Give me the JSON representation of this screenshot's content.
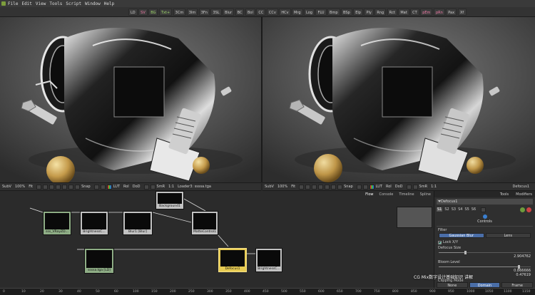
{
  "app": {
    "name": "Fusion"
  },
  "menu": [
    "File",
    "Edit",
    "View",
    "Tools",
    "Script",
    "Window",
    "Help"
  ],
  "toolbar": {
    "buttons": [
      {
        "label": "LD",
        "color": ""
      },
      {
        "label": "SV",
        "color": "pink"
      },
      {
        "label": "BG",
        "color": "green"
      },
      {
        "label": "Txt+",
        "color": "green"
      },
      {
        "label": "3Cm",
        "color": ""
      },
      {
        "label": "3Im",
        "color": ""
      },
      {
        "label": "3Fn",
        "color": ""
      },
      {
        "label": "3SL",
        "color": ""
      },
      {
        "label": "Blur",
        "color": ""
      },
      {
        "label": "BC",
        "color": ""
      },
      {
        "label": "Bol",
        "color": ""
      },
      {
        "label": "CC",
        "color": ""
      },
      {
        "label": "CCv",
        "color": ""
      },
      {
        "label": "HCv",
        "color": ""
      },
      {
        "label": "Mrg",
        "color": ""
      },
      {
        "label": "Log",
        "color": ""
      },
      {
        "label": "FLU",
        "color": ""
      },
      {
        "label": "Bmp",
        "color": ""
      },
      {
        "label": "BSp",
        "color": ""
      },
      {
        "label": "Elp",
        "color": ""
      },
      {
        "label": "Ply",
        "color": ""
      },
      {
        "label": "Rng",
        "color": ""
      },
      {
        "label": "Rct",
        "color": ""
      },
      {
        "label": "Mat",
        "color": ""
      },
      {
        "label": "CT",
        "color": ""
      },
      {
        "label": "pEm",
        "color": "pink"
      },
      {
        "label": "pRn",
        "color": "pink"
      },
      {
        "label": "Pax",
        "color": ""
      },
      {
        "label": "Xf",
        "color": ""
      }
    ]
  },
  "viewer_left": {
    "bar": {
      "subview": "SubV",
      "zoom": "100%",
      "fit": "Fit",
      "snap": "Snap",
      "lut": "LUT",
      "roi": "RoI",
      "dod": "DoD",
      "smr": "SmR",
      "ratio": "1:1",
      "loader": "Loader3: ssssa.tga"
    }
  },
  "viewer_right": {
    "bar": {
      "subview": "SubV",
      "zoom": "100%",
      "fit": "Fit",
      "snap": "Snap",
      "lut": "LUT",
      "roi": "RoI",
      "dod": "DoD",
      "smr": "SmR",
      "ratio": "1:1",
      "tool": "Defocus1"
    }
  },
  "flow": {
    "tabs": [
      "Flow",
      "Console",
      "Timeline",
      "Spline"
    ],
    "nodes": [
      {
        "label": "sss_VRayZD...",
        "kind": "green"
      },
      {
        "label": "BrightnessC...",
        "kind": "gray"
      },
      {
        "label": "Blur1 [Blur]",
        "kind": "gray"
      },
      {
        "label": "Background1",
        "kind": "gray"
      },
      {
        "label": "MatteControl1",
        "kind": "gray"
      },
      {
        "label": "ssssa.tga [LD]",
        "kind": "green"
      },
      {
        "label": "Defocus1",
        "kind": "yellow"
      },
      {
        "label": "BrightnessC...",
        "kind": "gray"
      }
    ]
  },
  "ruler": {
    "ticks": [
      "0",
      "10",
      "20",
      "30",
      "40",
      "50",
      "60",
      "100",
      "150",
      "200",
      "250",
      "300",
      "350",
      "400",
      "450",
      "500",
      "550",
      "600",
      "650",
      "700",
      "750",
      "800",
      "850",
      "900",
      "950",
      "1000",
      "1050",
      "1100",
      "1150"
    ]
  },
  "tools": {
    "tabs": [
      "Tools",
      "Modifiers"
    ],
    "tool_name": "Defocus1",
    "slots": [
      "S1",
      "S2",
      "S3",
      "S4",
      "S5",
      "S6"
    ],
    "controls_label": "Controls",
    "filter_label": "Filter",
    "filter_options": [
      "Gaussian Blur",
      "Lens"
    ],
    "filter_selected": 0,
    "lock_label": "Lock X/Y",
    "defocus_label": "Defocus Size",
    "defocus_value": "2.904762",
    "defocus_fraction": 0.29,
    "bloom_label": "Bloom Level",
    "bloom_value": "0.866666",
    "bloom_fraction": 0.87,
    "extra_value": "0.47619",
    "clipping_label": "Clipping Mode",
    "clipping_options": [
      "None",
      "Domain",
      "Frame"
    ],
    "clipping_selected": 1
  },
  "overlay": {
    "text": "CG Mix数字设计基础知识 讲解"
  }
}
